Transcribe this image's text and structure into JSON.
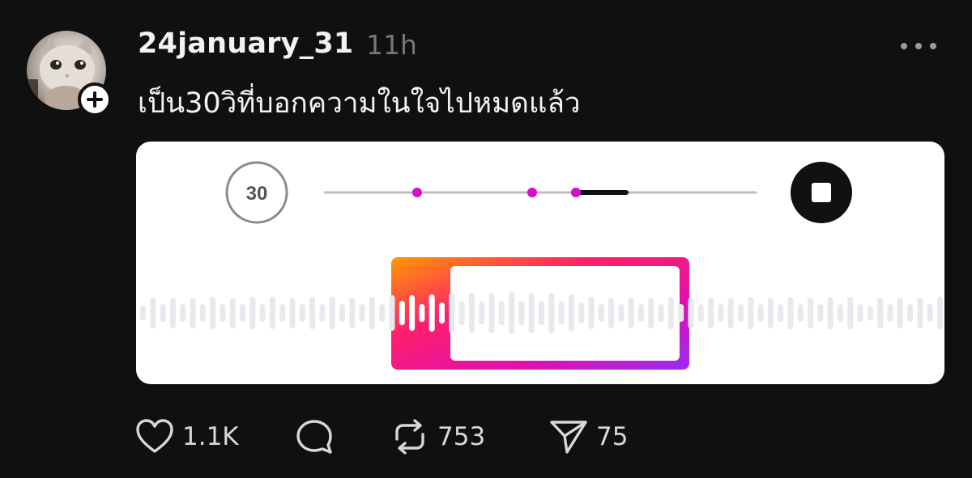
{
  "post": {
    "username": "24january_31",
    "time": "11h",
    "caption": "เป็น30วิที่บอกความในใจไปหมดแล้ว",
    "more_icon": "more-horizontal-icon",
    "follow_icon": "plus-icon"
  },
  "audio_editor": {
    "duration_label": "30",
    "accent_colors": [
      "#ff9a00",
      "#ff1f6b",
      "#d90fb8",
      "#9a2cf5"
    ],
    "marker_color": "#d40fcd",
    "stop_icon": "stop-icon"
  },
  "actions": {
    "like": {
      "icon": "heart-icon",
      "count": "1.1K"
    },
    "comment": {
      "icon": "comment-icon",
      "count": ""
    },
    "repost": {
      "icon": "repost-icon",
      "count": "753"
    },
    "share": {
      "icon": "send-icon",
      "count": "75"
    }
  }
}
